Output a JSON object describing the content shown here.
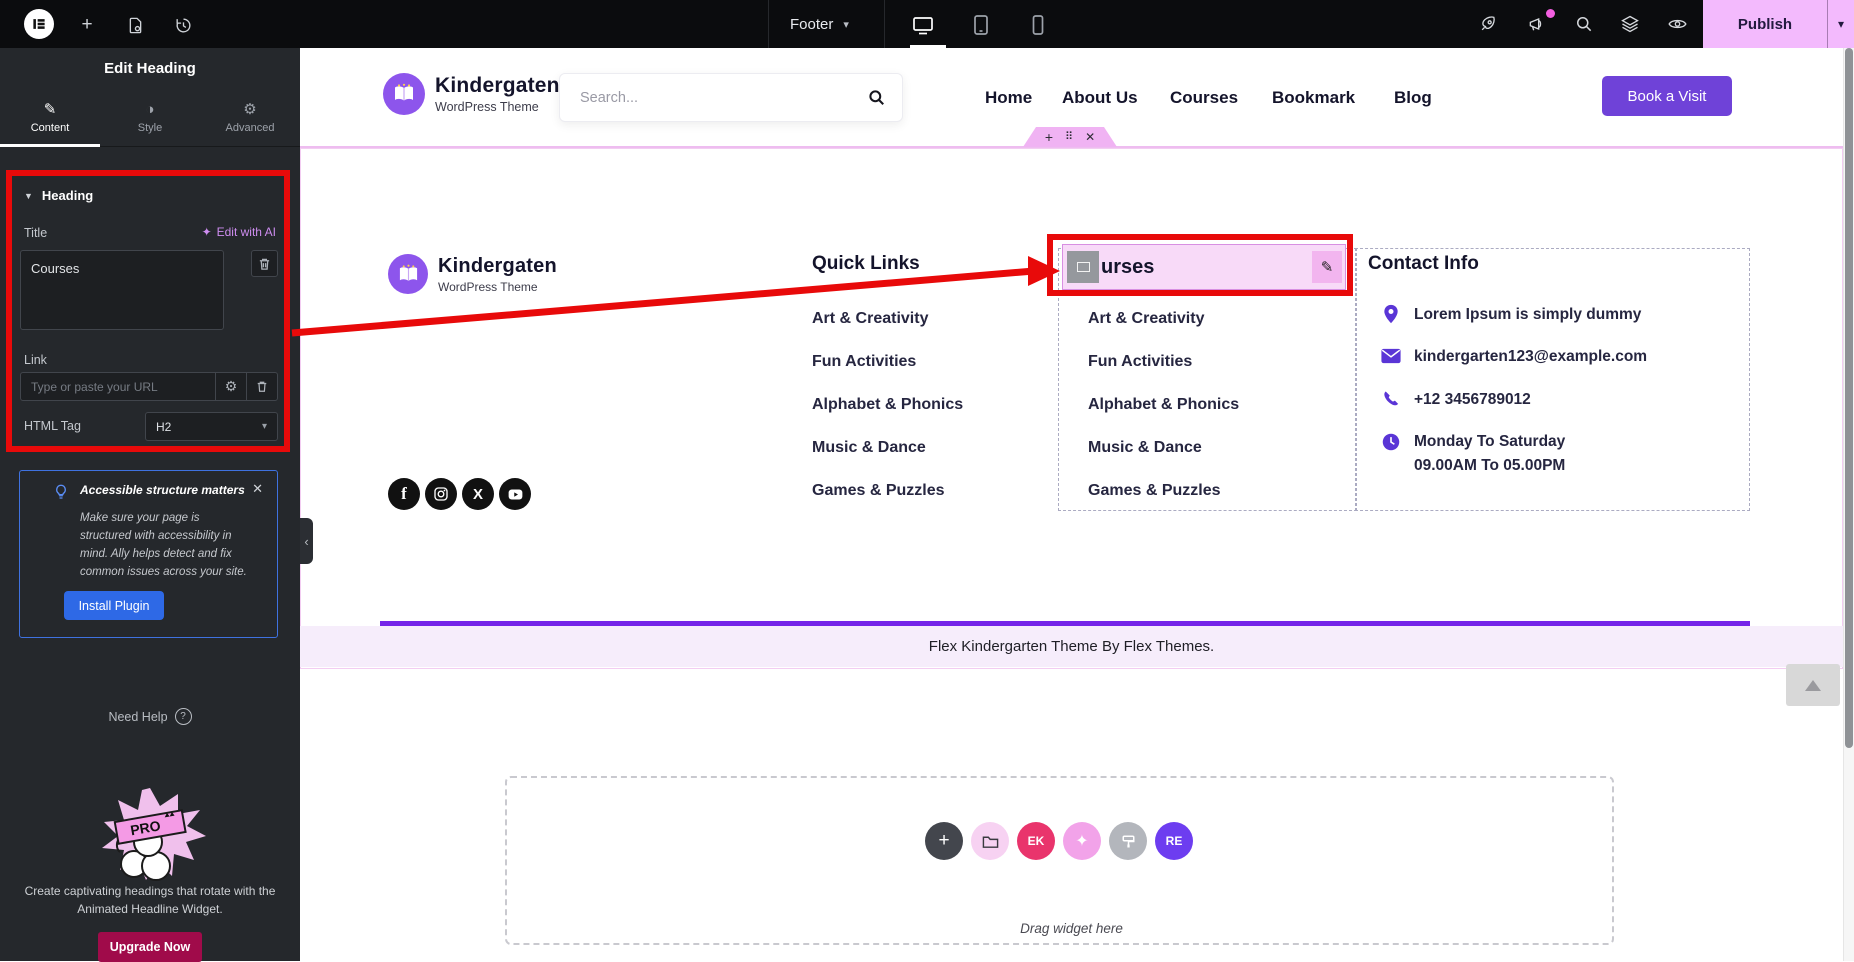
{
  "colors": {
    "topbar_bg": "#0b0c0e",
    "panel_bg": "#25282c",
    "publish_pink": "#f3bafd",
    "accent_purple": "#6f42d8",
    "divider_purple": "#7525e8",
    "bottom_strip_bg": "#f6edfb",
    "annotation_red": "#e80a0a",
    "install_blue": "#2e69e6",
    "upgrade_crimson": "#a00b4a",
    "ai_pink": "#ce8df0",
    "contact_icon_purple": "#5a35d6",
    "elementor_pink": "#f0b3f3"
  },
  "topbar": {
    "document_label": "Footer",
    "publish_label": "Publish",
    "left_icons": [
      "elementor-logo",
      "add-element",
      "page-settings",
      "history"
    ],
    "device_icons": [
      "desktop",
      "tablet",
      "mobile"
    ],
    "active_device": "desktop",
    "right_icons": [
      "rocket",
      "whats-new-megaphone",
      "finder-search",
      "structure-layers",
      "preview-eye"
    ]
  },
  "panel": {
    "header_title": "Edit Heading",
    "tabs": [
      "Content",
      "Style",
      "Advanced"
    ],
    "active_tab": "Content",
    "section_title": "Heading",
    "title_label": "Title",
    "ai_label": "Edit with AI",
    "title_value": "Courses",
    "link_label": "Link",
    "link_placeholder": "Type or paste your URL",
    "html_tag_label": "HTML Tag",
    "html_tag_value": "H2",
    "notice": {
      "title": "Accessible structure matters",
      "lines": [
        "Make sure your page is",
        "structured with accessibility in",
        "mind. Ally helps detect and fix",
        "common issues across your site."
      ],
      "button": "Install Plugin"
    },
    "need_help": "Need Help",
    "promo": {
      "badge": "PRO",
      "lines": [
        "Create captivating headings that rotate with the",
        "Animated Headline Widget."
      ],
      "button": "Upgrade Now"
    }
  },
  "header": {
    "brand_name": "Kindergaten",
    "brand_tagline": "WordPress Theme",
    "search_placeholder": "Search...",
    "nav": [
      "Home",
      "About Us",
      "Courses",
      "Bookmark",
      "Blog"
    ],
    "cta": "Book a Visit"
  },
  "footer": {
    "brand_name": "Kindergaten",
    "brand_tagline": "WordPress Theme",
    "social": [
      "facebook",
      "instagram",
      "x-twitter",
      "youtube"
    ],
    "quick_links_heading": "Quick Links",
    "links": [
      "Art & Creativity",
      "Fun Activities",
      "Alphabet & Phonics",
      "Music & Dance",
      "Games & Puzzles"
    ],
    "edited_heading_visible": "urses",
    "edited_heading_full": "Courses",
    "contact_heading": "Contact Info",
    "contact_items": [
      {
        "icon": "location-pin",
        "text": "Lorem Ipsum is simply dummy"
      },
      {
        "icon": "envelope",
        "text": "kindergarten123@example.com"
      },
      {
        "icon": "phone",
        "text": "+12 3456789012"
      },
      {
        "icon": "clock",
        "text": "Monday To Saturday",
        "text2": "09.00AM To 05.00PM"
      }
    ],
    "bottom_bar_text": "Flex Kindergarten Theme By Flex Themes."
  },
  "canvas": {
    "drag_hint": "Drag widget here",
    "add_buttons": [
      {
        "name": "add-section",
        "glyph": "+",
        "color": "#43464d"
      },
      {
        "name": "template-folder",
        "glyph": "",
        "color": "#f7d2f2"
      },
      {
        "name": "elementskit",
        "glyph": "EK",
        "color": "#e9346c"
      },
      {
        "name": "ai-sparkle",
        "glyph": "✦",
        "color": "#f2a3e9"
      },
      {
        "name": "addon",
        "glyph": "",
        "color": "#b3b6bc"
      },
      {
        "name": "royal-addons",
        "glyph": "RE",
        "color": "#6d3df0"
      }
    ]
  }
}
